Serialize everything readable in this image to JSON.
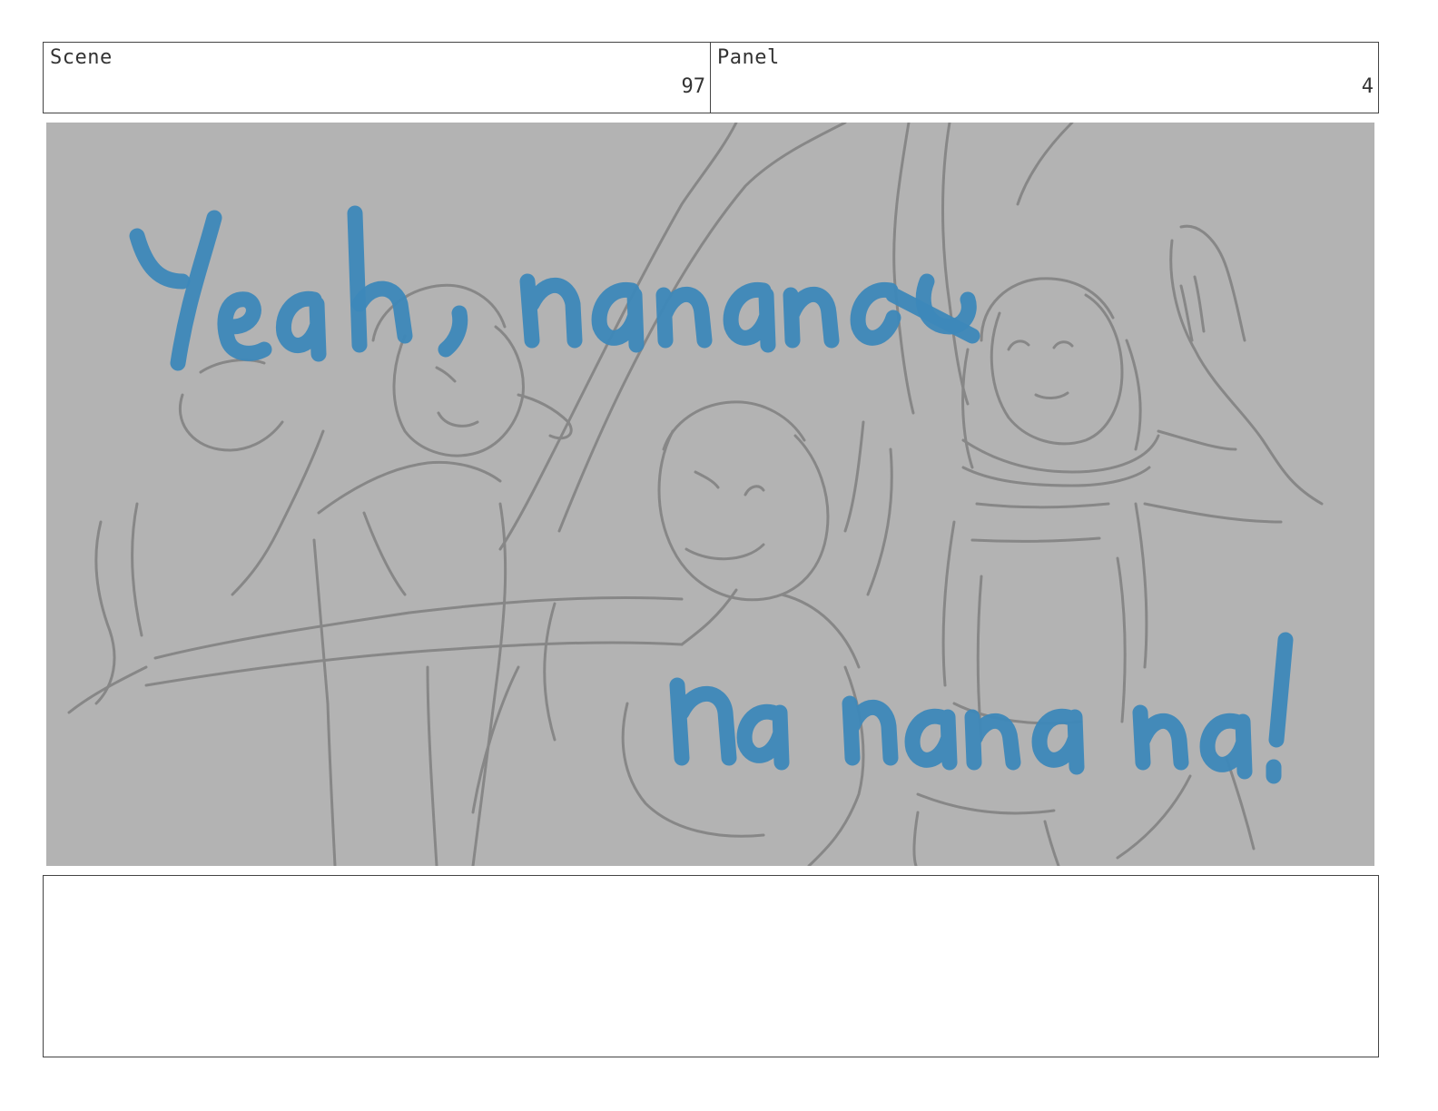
{
  "header": {
    "scene_label": "Scene",
    "scene_number": "97",
    "panel_label": "Panel",
    "panel_number": "4"
  },
  "frame": {
    "description_icon": "storyboard-sketch",
    "lyric_line_1": "Yeah, nanana",
    "lyric_line_2": "na nana na!",
    "background_color": "#b3b3b3",
    "sketch_color": "#878787",
    "lettering_color": "#3d88b9"
  },
  "notes": {
    "text": ""
  }
}
